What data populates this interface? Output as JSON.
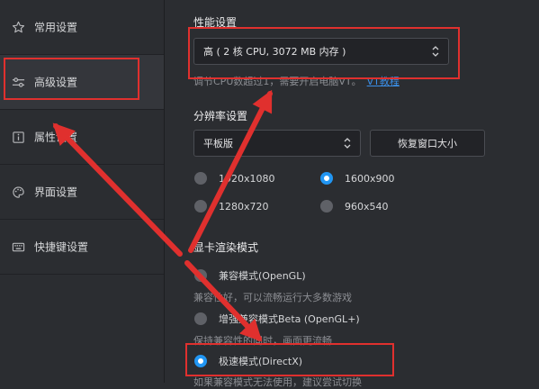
{
  "sidebar": {
    "items": [
      {
        "label": "常用设置",
        "icon": "star-icon"
      },
      {
        "label": "高级设置",
        "icon": "sliders-icon"
      },
      {
        "label": "属性设置",
        "icon": "info-icon"
      },
      {
        "label": "界面设置",
        "icon": "palette-icon"
      },
      {
        "label": "快捷键设置",
        "icon": "keyboard-icon"
      }
    ],
    "active_index": 1
  },
  "performance": {
    "title": "性能设置",
    "selected": "高 ( 2 核 CPU, 3072 MB 内存 )",
    "hint": "调节CPU数超过1，需要开启电脑VT。",
    "hint_link": "VT教程"
  },
  "resolution": {
    "title": "分辨率设置",
    "device_selected": "平板版",
    "restore_button": "恢复窗口大小",
    "options": [
      "1920x1080",
      "1600x900",
      "1280x720",
      "960x540"
    ],
    "selected_index": 1
  },
  "render": {
    "title": "显卡渲染模式",
    "modes": [
      {
        "label": "兼容模式(OpenGL)",
        "desc": "兼容性好，可以流畅运行大多数游戏"
      },
      {
        "label": "增强兼容模式Beta (OpenGL+)",
        "desc": "保持兼容性的同时，画面更流畅"
      },
      {
        "label": "极速模式(DirectX)",
        "desc": "如果兼容模式无法使用，建议尝试切换"
      }
    ],
    "selected_index": 2
  },
  "colors": {
    "background": "#2b2d31",
    "accent": "#2196f3",
    "annotation": "#e0302e",
    "link": "#3b8fe8"
  }
}
